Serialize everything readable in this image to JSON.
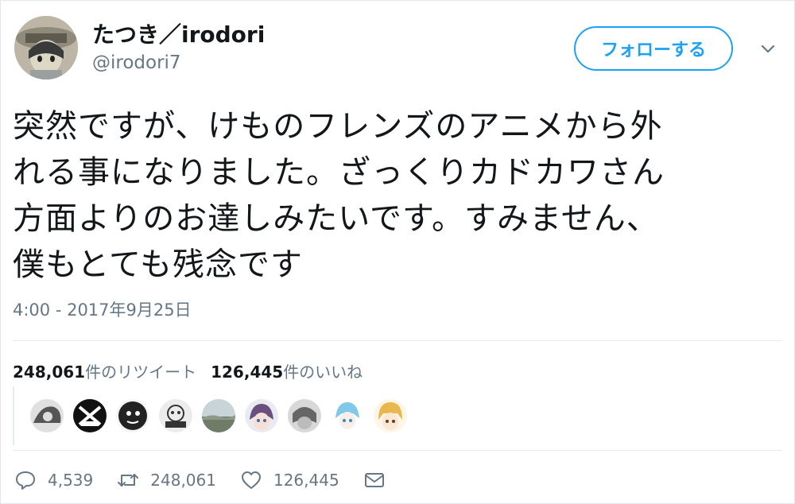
{
  "user": {
    "display_name": "たつき／irodori",
    "handle": "@irodori7"
  },
  "follow_button_label": "フォローする",
  "tweet": {
    "lines": [
      "突然ですが、けものフレンズのアニメから外",
      "れる事になりました。ざっくりカドカワさん",
      "方面よりのお達しみたいです。すみません、",
      "僕もとても残念です"
    ],
    "timestamp": "4:00 - 2017年9月25日"
  },
  "stats": {
    "retweets_count": "248,061",
    "retweets_label": "件のリツイート",
    "likes_count": "126,445",
    "likes_label": "件のいいね"
  },
  "likers": [
    {
      "icon": "avatar-1",
      "color": "#6b6b6b"
    },
    {
      "icon": "avatar-2",
      "color": "#1a1a1a"
    },
    {
      "icon": "avatar-3",
      "color": "#2b2b2b"
    },
    {
      "icon": "avatar-4",
      "color": "#9a9a9a"
    },
    {
      "icon": "avatar-5",
      "color": "#7a8a78"
    },
    {
      "icon": "avatar-6",
      "color": "#8a7fa0"
    },
    {
      "icon": "avatar-7",
      "color": "#808080"
    },
    {
      "icon": "avatar-8",
      "color": "#7ec8e8"
    },
    {
      "icon": "avatar-9",
      "color": "#e8c070"
    }
  ],
  "actions": {
    "reply_count": "4,539",
    "retweet_count": "248,061",
    "like_count": "126,445"
  },
  "colors": {
    "accent": "#1da1f2",
    "secondary_text": "#657786",
    "primary_text": "#14171a",
    "divider": "#e6ecf0"
  }
}
